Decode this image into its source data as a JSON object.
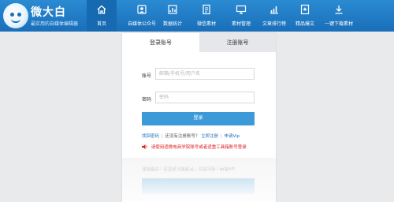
{
  "brand": {
    "title": "微大白",
    "subtitle": "最实用的自媒体编辑器"
  },
  "nav": [
    {
      "label": "首页",
      "icon": "home-icon",
      "active": true
    },
    {
      "label": "自媒体公众号",
      "icon": "media-account-icon",
      "active": false
    },
    {
      "label": "数据统计",
      "icon": "statistics-icon",
      "active": false
    },
    {
      "label": "微信素材",
      "icon": "wechat-material-icon",
      "active": false
    },
    {
      "label": "素材管理",
      "icon": "material-manage-icon",
      "active": false
    },
    {
      "label": "文章排行榜",
      "icon": "ranking-icon",
      "active": false
    },
    {
      "label": "精品爆文",
      "icon": "featured-article-icon",
      "active": false
    },
    {
      "label": "一键下载素材",
      "icon": "download-icon",
      "active": false
    }
  ],
  "login": {
    "tabs": {
      "login": "登录账号",
      "register": "注册账号"
    },
    "account_label": "账号",
    "account_placeholder": "邮箱/手机号/用户名",
    "password_label": "密码",
    "password_placeholder": "密码",
    "submit": "登录",
    "links": {
      "retrieve": "找回密码",
      "no_account": "还没有注册账号？",
      "register_now": "立即注册",
      "apply_vip": "申请Vip"
    },
    "warning": "请使用适微电商学院账号或者适重工具箱账号登录"
  },
  "colors": {
    "header": "#1a6fb9",
    "active_nav": "#156ab2",
    "button": "#3d9ad9",
    "link": "#1d6fb8",
    "warning": "#e02020"
  }
}
